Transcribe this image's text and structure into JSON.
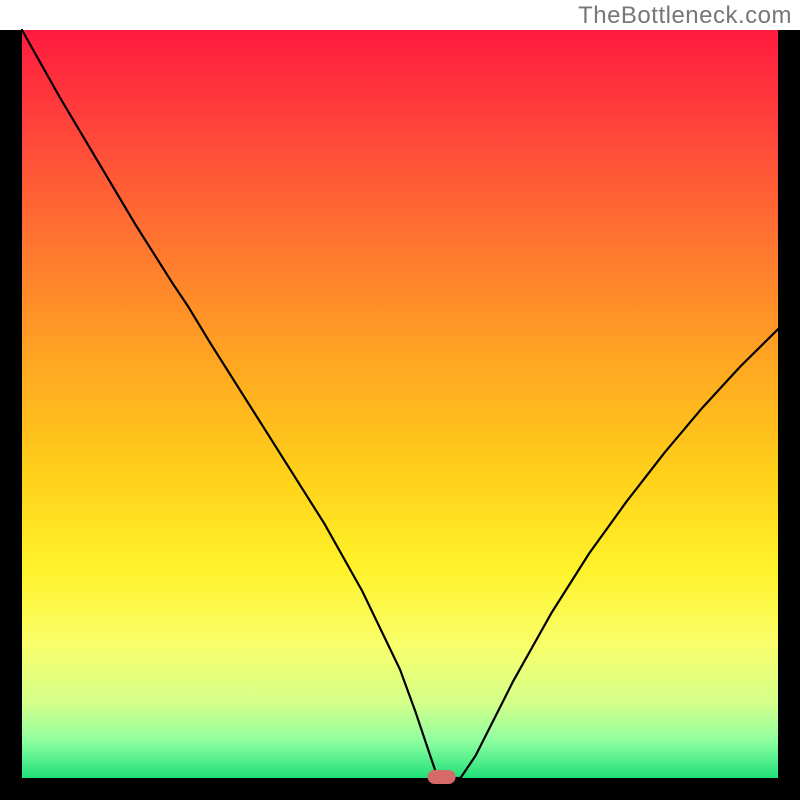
{
  "watermark": "TheBottleneck.com",
  "chart_data": {
    "type": "line",
    "title": "",
    "xlabel": "",
    "ylabel": "",
    "xlim": [
      0,
      100
    ],
    "ylim": [
      0,
      100
    ],
    "series": [
      {
        "name": "curve",
        "x": [
          0,
          5,
          10,
          15,
          20,
          22,
          25,
          30,
          35,
          40,
          45,
          50,
          52,
          54,
          55,
          56,
          58,
          60,
          65,
          70,
          75,
          80,
          85,
          90,
          95,
          100
        ],
        "y": [
          100,
          91,
          82.5,
          74,
          66,
          63,
          58,
          50,
          42,
          34,
          25,
          14.5,
          9,
          3,
          0,
          0,
          0,
          3,
          13,
          22,
          30,
          37,
          43.5,
          49.5,
          55,
          60
        ]
      }
    ],
    "marker": {
      "x": 55.5,
      "y": 0
    },
    "background_gradient": {
      "stops": [
        {
          "offset": 0.0,
          "color": "#ff1a3e"
        },
        {
          "offset": 0.15,
          "color": "#ff4a3a"
        },
        {
          "offset": 0.3,
          "color": "#ff7a2f"
        },
        {
          "offset": 0.45,
          "color": "#ffa821"
        },
        {
          "offset": 0.6,
          "color": "#ffd21a"
        },
        {
          "offset": 0.72,
          "color": "#fff22a"
        },
        {
          "offset": 0.82,
          "color": "#faff6a"
        },
        {
          "offset": 0.9,
          "color": "#d4ff8a"
        },
        {
          "offset": 0.95,
          "color": "#8fffa0"
        },
        {
          "offset": 1.0,
          "color": "#20e07a"
        }
      ]
    },
    "frame_color": "#000000",
    "curve_color": "#000000",
    "marker_color": "#d66a6a"
  }
}
